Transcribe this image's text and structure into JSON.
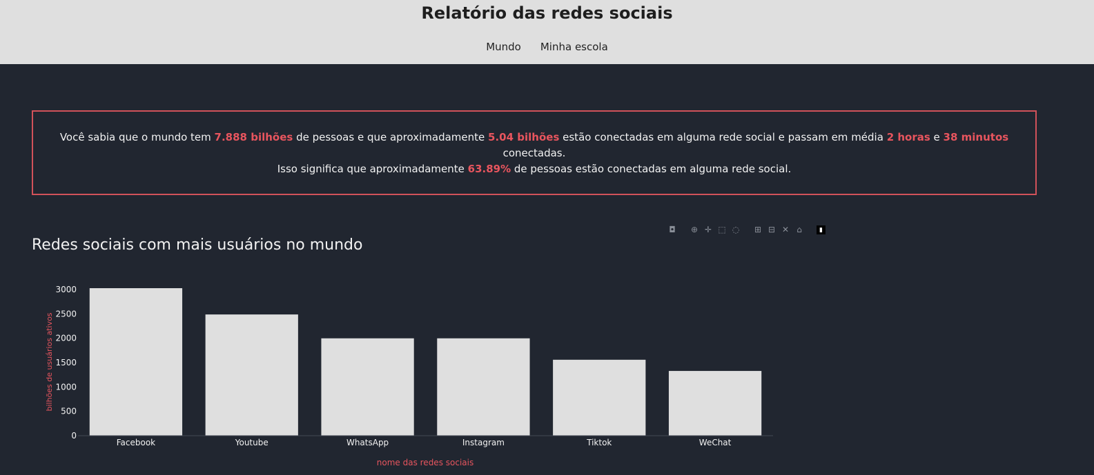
{
  "header": {
    "title": "Relatório das redes sociais",
    "nav": [
      "Mundo",
      "Minha escola"
    ]
  },
  "info": {
    "line1_pre": "Você sabia que o mundo tem ",
    "world_population": "7.888 bilhões",
    "line1_mid1": " de pessoas e que aproximadamente ",
    "connected_people": "5.04 bilhões",
    "line1_mid2": " estão conectadas em alguma rede social e passam em média ",
    "hours": "2 horas",
    "line1_mid3": " e ",
    "minutes": "38 minutos",
    "line1_end": " conectadas.",
    "line2_pre": "Isso significa que aproximadamente ",
    "percentage": "63.89%",
    "line2_end": " de pessoas estão conectadas em alguma rede social."
  },
  "modebar": {
    "icons": [
      "camera-icon",
      "zoom-icon",
      "pan-icon",
      "box-select-icon",
      "lasso-icon",
      "zoom-in-icon",
      "zoom-out-icon",
      "autoscale-icon",
      "reset-axes-icon",
      "plotly-logo-icon"
    ]
  },
  "colors": {
    "bar": "#dfdfdf",
    "accent": "#e8555e",
    "background": "#212630"
  },
  "chart_data": {
    "type": "bar",
    "title": "Redes sociais com mais usuários no mundo",
    "xlabel": "nome das redes sociais",
    "ylabel": "bilhões de usuários ativos",
    "categories": [
      "Facebook",
      "Youtube",
      "WhatsApp",
      "Instagram",
      "Tiktok",
      "WeChat"
    ],
    "values": [
      3030,
      2490,
      2000,
      2000,
      1560,
      1330
    ],
    "yticks": [
      0,
      500,
      1000,
      1500,
      2000,
      2500,
      3000
    ],
    "ylim": [
      0,
      3030
    ]
  }
}
